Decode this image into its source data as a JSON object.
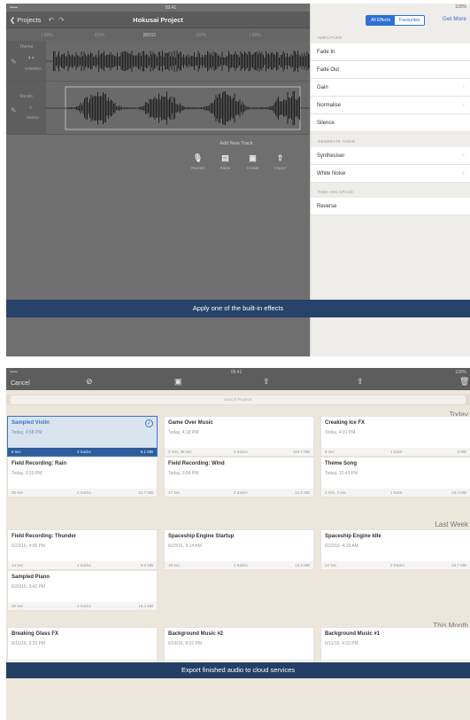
{
  "screen1": {
    "status_time": "09:41",
    "status_carrier": "•••••",
    "status_battery": "100%",
    "nav": {
      "back_label": "Projects",
      "title": "Hokusai Project"
    },
    "ruler": [
      "|:00%",
      "|00%",
      "|00:03",
      "|00%",
      "|:00%"
    ],
    "tracks": [
      {
        "name": "Theme",
        "mode_label": "STEREO"
      },
      {
        "name": "Vocals",
        "mode_label": "MONO"
      }
    ],
    "add_track": {
      "label": "Add New Track",
      "buttons": [
        "Record",
        "Paste",
        "Create",
        "Import"
      ]
    },
    "effects": {
      "segments": [
        "All Effects",
        "Favourites"
      ],
      "get_more": "Get More",
      "sections": [
        {
          "header": "AMPLITUDE",
          "items": [
            {
              "label": "Fade In",
              "chevron": false
            },
            {
              "label": "Fade Out",
              "chevron": false
            },
            {
              "label": "Gain",
              "chevron": true
            },
            {
              "label": "Normalise",
              "chevron": true
            },
            {
              "label": "Silence",
              "chevron": false
            }
          ]
        },
        {
          "header": "GENERATE AUDIO",
          "items": [
            {
              "label": "Synthesiser",
              "chevron": true
            },
            {
              "label": "White Noise",
              "chevron": true
            }
          ]
        },
        {
          "header": "TIME AND SPACE",
          "items": [
            {
              "label": "Reverse",
              "chevron": false
            }
          ]
        }
      ]
    },
    "banner": "Apply one of the built-in effects"
  },
  "screen2": {
    "status_time": "09:41",
    "status_carrier": "•••••",
    "status_battery": "100%",
    "cancel_label": "Cancel",
    "search_placeholder": "Search Projects",
    "groups": [
      {
        "header": "Today"
      },
      {
        "header": "Last Week"
      },
      {
        "header": "This Month"
      }
    ],
    "projects": [
      {
        "title": "Sampled Violin",
        "date": "Today, 4:58 PM",
        "duration": "6 sec",
        "tracks": "2 tracks",
        "size": "6.1 MB",
        "selected": true
      },
      {
        "title": "Game Over Music",
        "date": "Today, 4:18 PM",
        "duration": "2 min, 36 sec",
        "tracks": "2 tracks",
        "size": "110.7 MB",
        "selected": false
      },
      {
        "title": "Creaking Ice FX",
        "date": "Today, 4:01 PM",
        "duration": "8 sec",
        "tracks": "1 track",
        "size": "3 MB",
        "selected": false
      },
      {
        "title": "Field Recording: Rain",
        "date": "Today, 3:20 PM",
        "duration": "30 sec",
        "tracks": "2 tracks",
        "size": "21.7 MB",
        "selected": false
      },
      {
        "title": "Field Recording: Wind",
        "date": "Today, 3:06 PM",
        "duration": "17 sec",
        "tracks": "2 tracks",
        "size": "12.6 MB",
        "selected": false
      },
      {
        "title": "Theme Song",
        "date": "Today, 12:43 PM",
        "duration": "2 min, 3 sec",
        "tracks": "1 track",
        "size": "43.4 MB",
        "selected": false
      },
      {
        "title": "Field Recording: Thunder",
        "date": "6/23/16, 4:06 PM",
        "duration": "14 sec",
        "tracks": "2 tracks",
        "size": "9.9 MB",
        "selected": false
      },
      {
        "title": "Spaceship Engine Startup",
        "date": "6/23/16, 9:14 AM",
        "duration": "18 sec",
        "tracks": "2 tracks",
        "size": "13.3 MB",
        "selected": false
      },
      {
        "title": "Spaceship Engine Idle",
        "date": "6/22/16, 4:18 AM",
        "duration": "22 sec",
        "tracks": "2 tracks",
        "size": "15.7 MB",
        "selected": false
      },
      {
        "title": "Sampled Piano",
        "date": "6/20/16, 3:42 PM",
        "duration": "26 sec",
        "tracks": "2 tracks",
        "size": "18.4 MB",
        "selected": false
      },
      {
        "title": "Breaking Glass FX",
        "date": "6/15/16, 3:35 PM",
        "duration": "",
        "tracks": "",
        "size": "",
        "selected": false
      },
      {
        "title": "Background Music #2",
        "date": "6/14/16, 8:01 PM",
        "duration": "",
        "tracks": "",
        "size": "",
        "selected": false
      },
      {
        "title": "Background Music #1",
        "date": "6/11/16, 4:33 PM",
        "duration": "",
        "tracks": "",
        "size": "",
        "selected": false
      }
    ],
    "banner": "Export finished audio to cloud services"
  }
}
